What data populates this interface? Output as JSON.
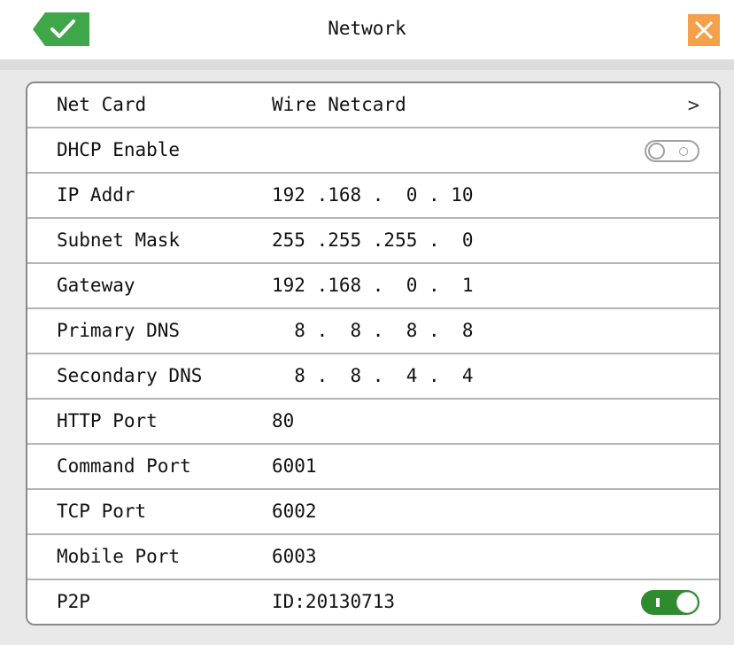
{
  "header": {
    "title": "Network",
    "ok_icon": "checkmark-icon",
    "close_icon": "close-icon",
    "ok_color": "#3fa64a",
    "close_color": "#f5a04a"
  },
  "rows": [
    {
      "label": "Net Card",
      "value": "Wire Netcard",
      "control": "chevron-right-icon"
    },
    {
      "label": "DHCP Enable",
      "value": "",
      "control": "toggle-off"
    },
    {
      "label": "IP Addr",
      "value": "192 .168 .  0 . 10"
    },
    {
      "label": "Subnet Mask",
      "value": "255 .255 .255 .  0"
    },
    {
      "label": "Gateway",
      "value": "192 .168 .  0 .  1"
    },
    {
      "label": "Primary DNS",
      "value": "  8 .  8 .  8 .  8"
    },
    {
      "label": "Secondary DNS",
      "value": "  8 .  8 .  4 .  4"
    },
    {
      "label": "HTTP Port",
      "value": "80"
    },
    {
      "label": "Command Port",
      "value": "6001"
    },
    {
      "label": "TCP Port",
      "value": "6002"
    },
    {
      "label": "Mobile Port",
      "value": "6003"
    },
    {
      "label": "P2P",
      "value": "ID:20130713",
      "control": "toggle-on"
    }
  ],
  "toggles": {
    "dhcp_enabled": false,
    "p2p_enabled": true,
    "on_color": "#2e8b2e"
  },
  "chevron_glyph": ">"
}
